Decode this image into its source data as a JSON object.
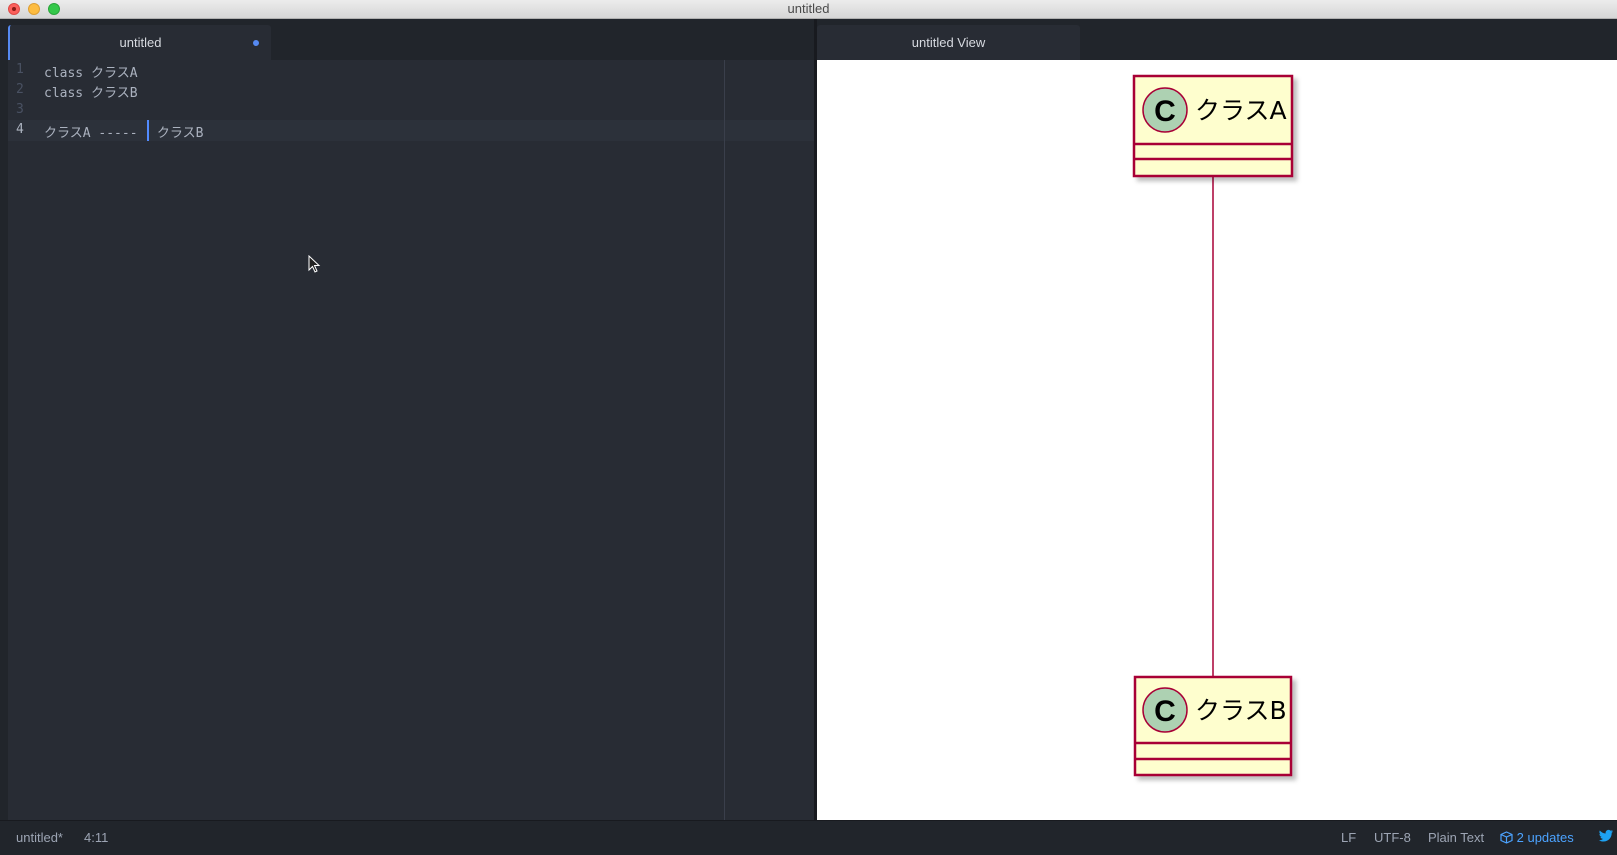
{
  "window": {
    "title": "untitled"
  },
  "editor": {
    "tab_label": "untitled",
    "lines": [
      {
        "num": "1",
        "text": "class クラスA"
      },
      {
        "num": "2",
        "text": "class クラスB"
      },
      {
        "num": "3",
        "text": ""
      },
      {
        "num": "4",
        "text": "クラスA -----",
        "text_after_cursor": " クラスB"
      }
    ]
  },
  "preview": {
    "tab_label": "untitled View",
    "classes": [
      {
        "stereotype": "C",
        "name": "クラスA"
      },
      {
        "stereotype": "C",
        "name": "クラスB"
      }
    ],
    "colors": {
      "class_fill": "#fefece",
      "class_border": "#a80036",
      "circle_fill": "#add1b2"
    }
  },
  "status": {
    "file": "untitled*",
    "cursor_pos": "4:11",
    "line_ending": "LF",
    "encoding": "UTF-8",
    "grammar": "Plain Text",
    "updates": "2 updates"
  },
  "colors": {
    "accent": "#568af2",
    "editor_bg": "#282c34"
  }
}
